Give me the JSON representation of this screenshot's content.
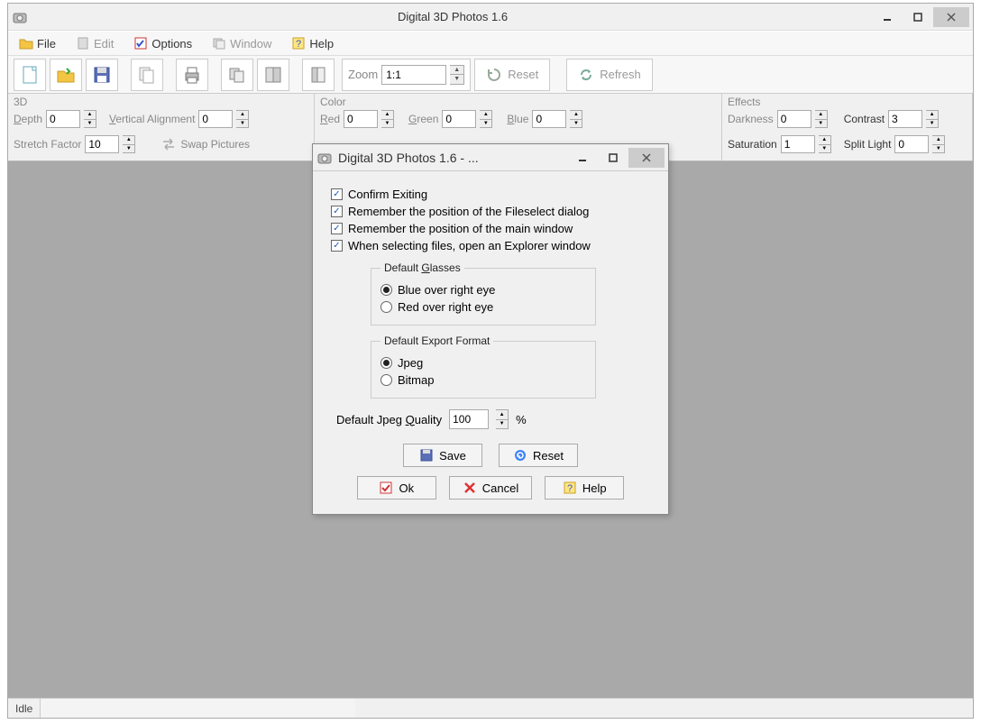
{
  "window": {
    "title": "Digital 3D Photos 1.6"
  },
  "menu": {
    "file": "File",
    "edit": "Edit",
    "options": "Options",
    "window": "Window",
    "help": "Help"
  },
  "toolbar": {
    "zoom_label": "Zoom",
    "zoom_value": "1:1",
    "reset": "Reset",
    "refresh": "Refresh"
  },
  "panel3d": {
    "title": "3D",
    "depth_label": "Depth",
    "depth_value": "0",
    "valign_label": "Vertical Alignment",
    "valign_value": "0",
    "stretch_label": "Stretch Factor",
    "stretch_value": "10",
    "swap_label": "Swap Pictures"
  },
  "panelColor": {
    "title": "Color",
    "red_label": "Red",
    "red_value": "0",
    "green_label": "Green",
    "green_value": "0",
    "blue_label": "Blue",
    "blue_value": "0"
  },
  "panelEffects": {
    "title": "Effects",
    "darkness_label": "Darkness",
    "darkness_value": "0",
    "contrast_label": "Contrast",
    "contrast_value": "3",
    "saturation_label": "Saturation",
    "saturation_value": "1",
    "split_label": "Split Light",
    "split_value": "0"
  },
  "status": {
    "text": "Idle"
  },
  "dialog": {
    "title": "Digital 3D Photos 1.6 - ...",
    "chk_confirm": "Confirm Exiting",
    "chk_fileselect": "Remember the position of the Fileselect dialog",
    "chk_mainwin": "Remember the position of the main window",
    "chk_explorer": "When selecting files, open an Explorer window",
    "glasses_legend": "Default Glasses",
    "glasses_blue": "Blue over right eye",
    "glasses_red": "Red over right eye",
    "export_legend": "Default Export Format",
    "export_jpeg": "Jpeg",
    "export_bitmap": "Bitmap",
    "jpeg_label": "Default Jpeg Quality",
    "jpeg_value": "100",
    "jpeg_suffix": "%",
    "btn_save": "Save",
    "btn_reset": "Reset",
    "btn_ok": "Ok",
    "btn_cancel": "Cancel",
    "btn_help": "Help"
  }
}
